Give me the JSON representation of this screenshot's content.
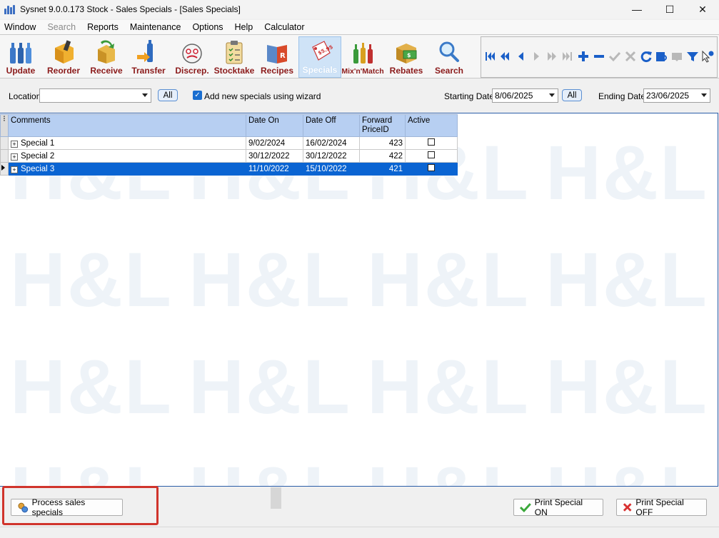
{
  "window": {
    "title": "Sysnet 9.0.0.173 Stock - Sales Specials - [Sales Specials]",
    "minimize": "—",
    "maximize": "☐",
    "close": "✕"
  },
  "menu": [
    "Window",
    "Search",
    "Reports",
    "Maintenance",
    "Options",
    "Help",
    "Calculator"
  ],
  "toolbar": {
    "buttons": [
      {
        "label": "Update",
        "icon": "bottles-icon"
      },
      {
        "label": "Reorder",
        "icon": "reorder-box-icon"
      },
      {
        "label": "Receive",
        "icon": "receive-box-icon"
      },
      {
        "label": "Transfer",
        "icon": "transfer-bottle-icon"
      },
      {
        "label": "Discrep.",
        "icon": "discrepancy-face-icon"
      },
      {
        "label": "Stocktake",
        "icon": "clipboard-icon"
      },
      {
        "label": "Recipes",
        "icon": "recipe-book-icon"
      },
      {
        "label": "Specials",
        "icon": "specials-tag-icon"
      },
      {
        "label": "Mix'n'Match",
        "icon": "mix-match-bottles-icon"
      },
      {
        "label": "Rebates",
        "icon": "rebates-money-icon"
      },
      {
        "label": "Search",
        "icon": "magnifier-icon"
      }
    ],
    "active": "Specials"
  },
  "navigator": [
    "first-record-icon",
    "prev-page-icon",
    "prev-record-icon",
    "next-record-icon",
    "next-page-icon",
    "last-record-icon",
    "add-icon",
    "delete-icon",
    "confirm-icon",
    "cancel-icon",
    "refresh-icon",
    "search-book-icon",
    "bookmark-icon",
    "filter-icon",
    "help-cursor-icon"
  ],
  "filters": {
    "location_label": "Location",
    "location_value": "",
    "location_all": "All",
    "wizard_checked": true,
    "wizard_label": "Add new specials using wizard",
    "start_label": "Starting Date",
    "start_value": "8/06/2025",
    "start_all": "All",
    "end_label": "Ending Date",
    "end_value": "23/06/2025"
  },
  "grid": {
    "columns": [
      "Comments",
      "Date On",
      "Date Off",
      "Forward PriceID",
      "Active"
    ],
    "rows": [
      {
        "comment": "Special 1",
        "date_on": "9/02/2024",
        "date_off": "16/02/2024",
        "price_id": "423",
        "active": false,
        "selected": false
      },
      {
        "comment": "Special 2",
        "date_on": "30/12/2022",
        "date_off": "30/12/2022",
        "price_id": "422",
        "active": false,
        "selected": false
      },
      {
        "comment": "Special 3",
        "date_on": "11/10/2022",
        "date_off": "15/10/2022",
        "price_id": "421",
        "active": false,
        "selected": true
      }
    ]
  },
  "watermark": "H&L",
  "bottom": {
    "process_label": "Process sales specials",
    "print_on_label": "Print Special ON",
    "print_off_label": "Print Special OFF"
  },
  "colors": {
    "highlight": "#d0342c",
    "selection": "#0a64d2",
    "header": "#b7cff2",
    "toolbar_label": "#8b1a1a"
  }
}
